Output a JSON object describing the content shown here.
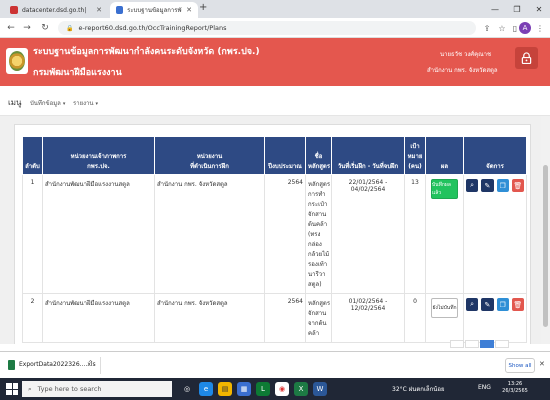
{
  "browser": {
    "tabs": [
      {
        "title": "datacenter.dsd.go.th|",
        "active": false
      },
      {
        "title": "ระบบฐานข้อมูลการพัฒนากำลังคนระดับ...",
        "active": true
      }
    ],
    "url": "e-report60.dsd.go.th/OccTrainingReport/Plans",
    "profile_initial": "A"
  },
  "site": {
    "title": "ระบบฐานข้อมูลการพัฒนากำลังคนระดับจังหวัด (กพร.ปจ.)",
    "subtitle": "กรมพัฒนาฝีมือแรงงาน",
    "user_name": "นายธวัช วงศ์คุณาช",
    "user_office": "สำนักงาน กพร. จังหวัดสตูล",
    "header_color": "#e4574e"
  },
  "menu": {
    "label": "เมนู",
    "items": [
      "บันทึกข้อมูล",
      "รายงาน"
    ]
  },
  "table": {
    "headers": [
      "ลำดับ",
      "หน่วยงานเจ้าภาพการ\nกพร.ปจ.",
      "หน่วยงาน\nที่ดำเนินการฝึก",
      "ปีงบประมาณ",
      "ชื่อ\nหลักสูตร",
      "วันที่เริ่มฝึก - วันที่จบฝึก",
      "เป้า\nหมาย\n(คน)",
      "ผล",
      "จัดการ"
    ],
    "rows": [
      {
        "no": "1",
        "host": "สำนักงานพัฒนาฝีมือแรงงานสตูล",
        "agency": "สำนักงาน กพร. จังหวัดสตูล",
        "year": "2564",
        "course": "หลักสูตรการทำกระเป๋าจักสานต้นคล้า (ทรงกล่องกล้วยไม้รองเท้านารีวาสตูล)",
        "dates": "22/01/2564 - 04/02/2564",
        "target": "13",
        "result_label": "บันทึกผลแล้ว",
        "result_state": "done"
      },
      {
        "no": "2",
        "host": "สำนักงานพัฒนาฝีมือแรงงานสตูล",
        "agency": "สำนักงาน กพร. จังหวัดสตูล",
        "year": "2564",
        "course": "หลักสูตรจักสานจากต้นคล้า",
        "dates": "01/02/2564 - 12/02/2564",
        "target": "0",
        "result_label": "ยังไม่บันทึก",
        "result_state": "pending"
      }
    ]
  },
  "download": {
    "file_name": "ExportData2022326....xls",
    "show_all": "Show all"
  },
  "taskbar": {
    "search_placeholder": "Type here to search",
    "weather": "32°C ฝนตกเล็กน้อย",
    "lang": "ENG",
    "time": "13:26",
    "date": "26/3/2565"
  }
}
